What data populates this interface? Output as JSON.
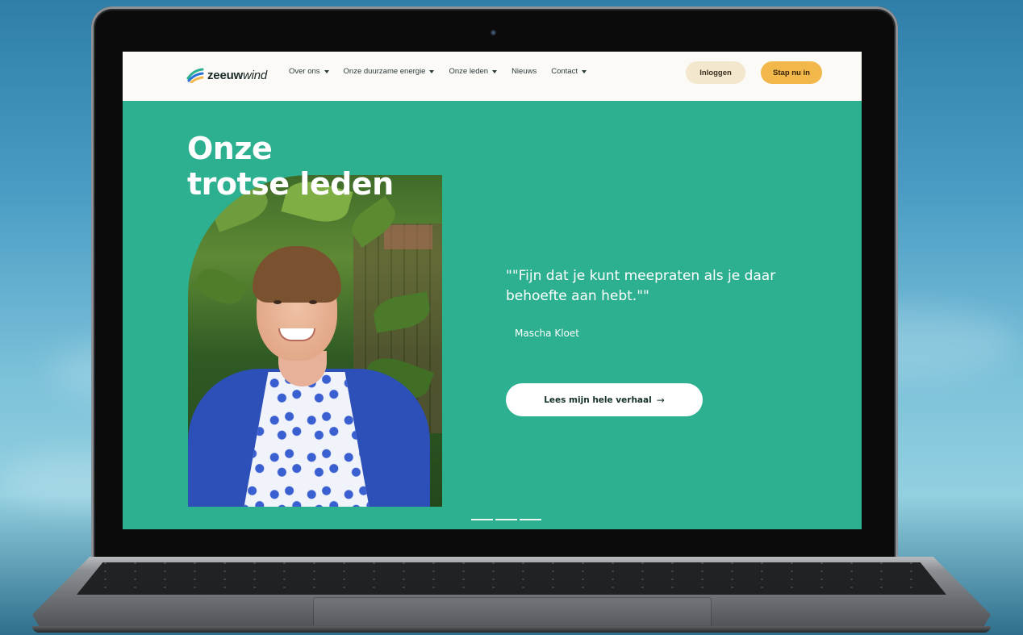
{
  "brand": {
    "name_bold": "zeeuw",
    "name_light": "wind"
  },
  "nav": {
    "items": [
      {
        "label": "Over ons",
        "has_dropdown": true
      },
      {
        "label": "Onze duurzame energie",
        "has_dropdown": true
      },
      {
        "label": "Onze leden",
        "has_dropdown": true
      },
      {
        "label": "Nieuws",
        "has_dropdown": false
      },
      {
        "label": "Contact",
        "has_dropdown": true
      }
    ],
    "login_label": "Inloggen",
    "join_label": "Stap nu in"
  },
  "hero": {
    "title_line1": "Onze",
    "title_line2": "trotse leden",
    "quote": "\"\"Fijn dat je kunt meepraten als je daar behoefte aan hebt.\"\"",
    "author": "Mascha Kloet",
    "cta_label": "Lees mijn hele verhaal",
    "cta_icon": "arrow-right-icon",
    "carousel_slides": 3
  },
  "colors": {
    "hero_bg": "#2db08f",
    "nav_bg": "#fbfaf6",
    "login_bg": "#f3e7cd",
    "join_bg": "#f2b84b"
  }
}
